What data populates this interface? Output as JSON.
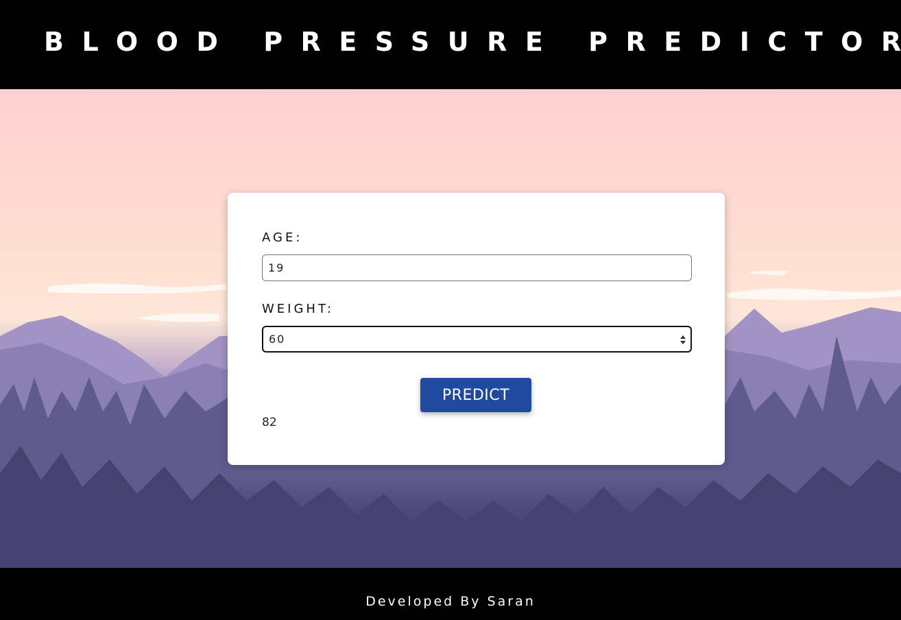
{
  "header": {
    "title": "BLOOD PRESSURE PREDICTOR"
  },
  "form": {
    "age_label": "AGE:",
    "age_value": "19",
    "weight_label": "WEIGHT:",
    "weight_value": "60",
    "predict_label": "PREDICT",
    "result": "82"
  },
  "footer": {
    "credit": "Developed By Saran"
  },
  "colors": {
    "button": "#1f4aa0",
    "header_bg": "#000000",
    "card_bg": "#ffffff"
  },
  "icons": {
    "spinner": "number-spinner-icon"
  }
}
